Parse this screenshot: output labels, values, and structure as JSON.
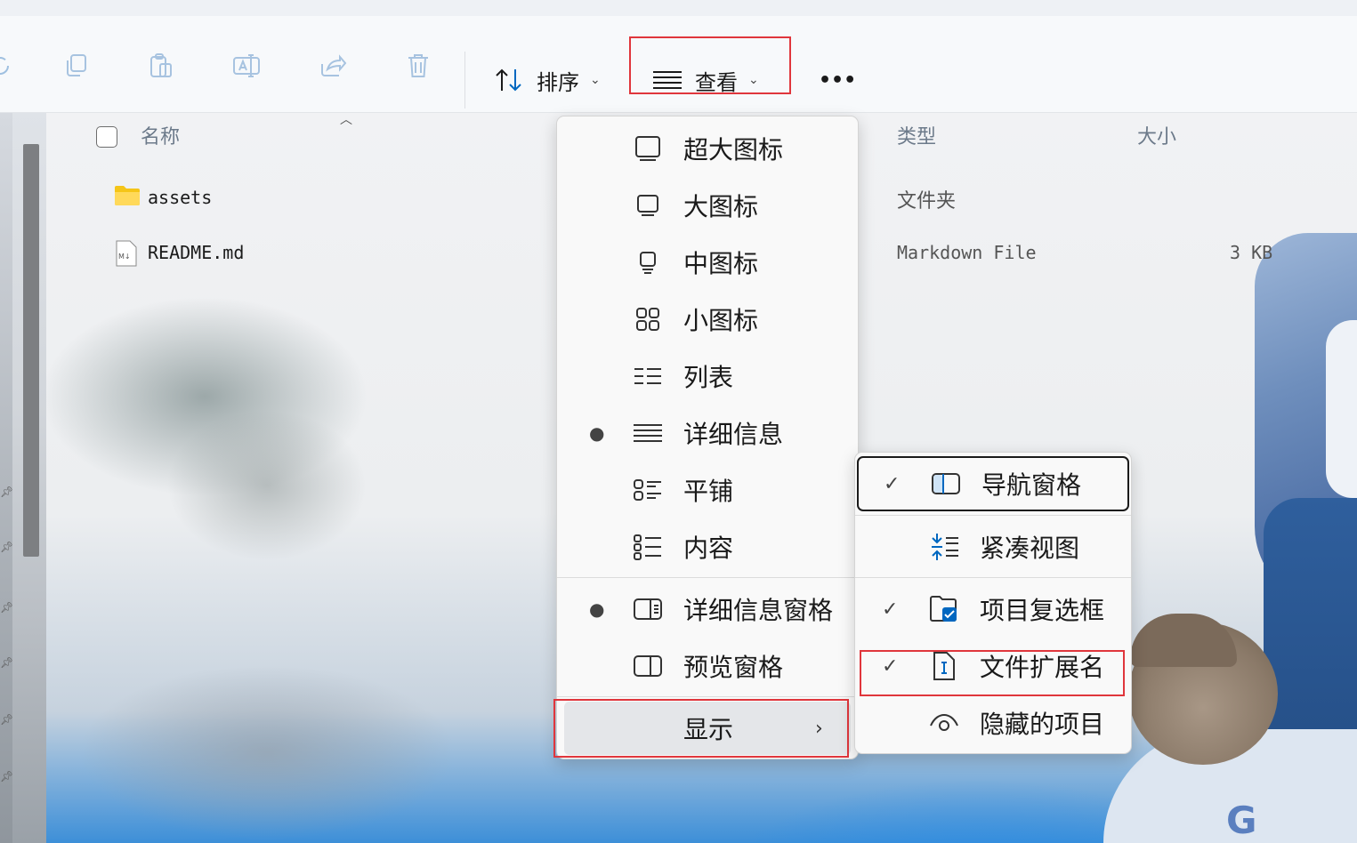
{
  "toolbar": {
    "icons": [
      "refresh-icon",
      "copy-icon",
      "paste-icon",
      "rename-icon",
      "share-icon",
      "delete-icon"
    ],
    "sort_label": "排序",
    "view_label": "查看",
    "more_label": "•••"
  },
  "columns": {
    "name": "名称",
    "type": "类型",
    "size": "大小"
  },
  "files": [
    {
      "name": "assets",
      "type": "文件夹",
      "size": "",
      "icon": "folder-icon"
    },
    {
      "name": "README.md",
      "type": "Markdown File",
      "size": "3 KB",
      "icon": "markdown-file-icon"
    }
  ],
  "view_menu": {
    "items": [
      {
        "label": "超大图标",
        "icon": "extra-large-icons-icon",
        "selected": false
      },
      {
        "label": "大图标",
        "icon": "large-icons-icon",
        "selected": false
      },
      {
        "label": "中图标",
        "icon": "medium-icons-icon",
        "selected": false
      },
      {
        "label": "小图标",
        "icon": "small-icons-icon",
        "selected": false
      },
      {
        "label": "列表",
        "icon": "list-icon",
        "selected": false
      },
      {
        "label": "详细信息",
        "icon": "details-icon",
        "selected": true
      },
      {
        "label": "平铺",
        "icon": "tiles-icon",
        "selected": false
      },
      {
        "label": "内容",
        "icon": "content-icon",
        "selected": false
      }
    ],
    "panes": [
      {
        "label": "详细信息窗格",
        "icon": "details-pane-icon",
        "selected": true
      },
      {
        "label": "预览窗格",
        "icon": "preview-pane-icon",
        "selected": false
      }
    ],
    "show_label": "显示"
  },
  "show_menu": {
    "items": [
      {
        "label": "导航窗格",
        "icon": "navigation-pane-icon",
        "checked": true
      },
      {
        "label": "紧凑视图",
        "icon": "compact-view-icon",
        "checked": false
      },
      {
        "label": "项目复选框",
        "icon": "item-checkboxes-icon",
        "checked": true
      },
      {
        "label": "文件扩展名",
        "icon": "file-extensions-icon",
        "checked": true
      },
      {
        "label": "隐藏的项目",
        "icon": "hidden-items-icon",
        "checked": false
      }
    ],
    "check_glyph": "✓"
  },
  "colors": {
    "highlight_red": "#e0363c",
    "accent_blue": "#0067c0"
  }
}
